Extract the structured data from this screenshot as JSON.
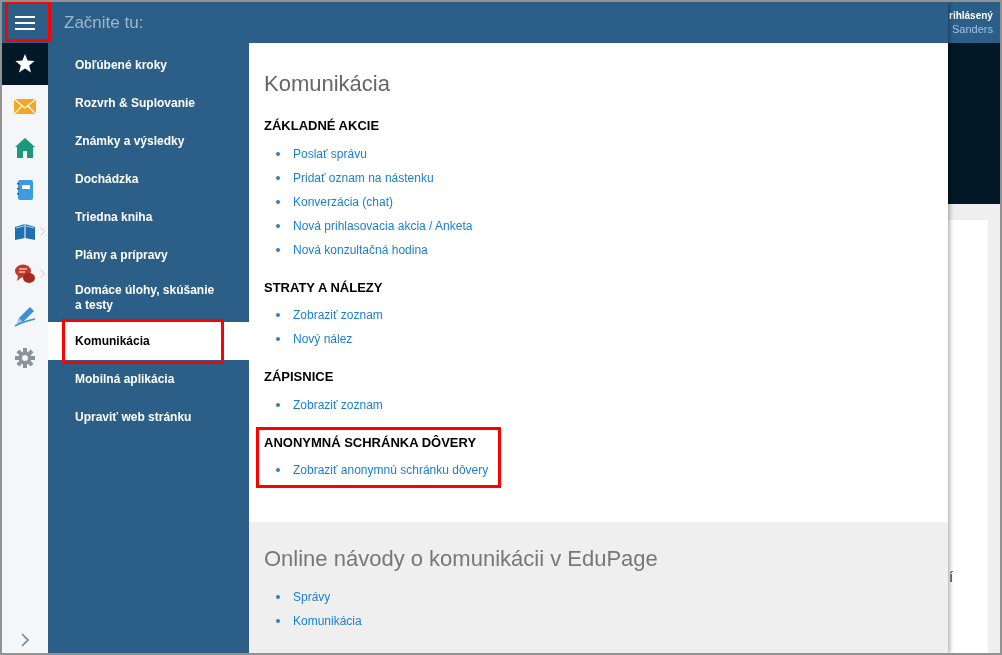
{
  "menu_button": {
    "highlighted": true
  },
  "rail_items": [
    {
      "selected": true,
      "submenu": false
    },
    {
      "selected": false,
      "submenu": false
    },
    {
      "selected": false,
      "submenu": false
    },
    {
      "selected": false,
      "submenu": false
    },
    {
      "selected": false,
      "submenu": true
    },
    {
      "selected": false,
      "submenu": true
    },
    {
      "selected": false,
      "submenu": false
    },
    {
      "selected": false,
      "submenu": false
    }
  ],
  "header": {
    "title": "Začnite tu:",
    "user_line_1": "rihlásený",
    "user_line_2": "Sanders"
  },
  "menu_items": [
    {
      "label": "Obľúbené kroky",
      "selected": false,
      "highlighted": false
    },
    {
      "label": "Rozvrh & Suplovanie",
      "selected": false,
      "highlighted": false
    },
    {
      "label": "Známky a výsledky",
      "selected": false,
      "highlighted": false
    },
    {
      "label": "Dochádzka",
      "selected": false,
      "highlighted": false
    },
    {
      "label": "Triedna kniha",
      "selected": false,
      "highlighted": false
    },
    {
      "label": "Plány a prípravy",
      "selected": false,
      "highlighted": false
    },
    {
      "label": "Domáce úlohy, skúšanie a testy",
      "selected": false,
      "highlighted": false
    },
    {
      "label": "Komunikácia",
      "selected": true,
      "highlighted": true
    },
    {
      "label": "Mobilná aplikácia",
      "selected": false,
      "highlighted": false
    },
    {
      "label": "Upraviť web stránku",
      "selected": false,
      "highlighted": false
    }
  ],
  "panel": {
    "title": "Komunikácia",
    "sections": [
      {
        "heading": "ZÁKLADNÉ AKCIE",
        "highlighted": false,
        "links": [
          "Poslať správu",
          "Pridať oznam na nástenku",
          "Konverzácia (chat)",
          "Nová prihlasovacia akcia / Anketa",
          "Nová konzultačná hodina"
        ]
      },
      {
        "heading": "STRATY A NÁLEZY",
        "highlighted": false,
        "links": [
          "Zobraziť zoznam",
          "Nový nález"
        ]
      },
      {
        "heading": "ZÁPISNICE",
        "highlighted": false,
        "links": [
          "Zobraziť zoznam"
        ]
      },
      {
        "heading": "ANONYMNÁ SCHRÁNKA DÔVERY",
        "highlighted": true,
        "links": [
          "Zobraziť anonymnú schránku dôvery"
        ]
      }
    ]
  },
  "guides": {
    "title": "Online návody o komunikácii v EduPage",
    "links": [
      "Správy",
      "Komunikácia"
    ]
  },
  "background_fragment": "í"
}
